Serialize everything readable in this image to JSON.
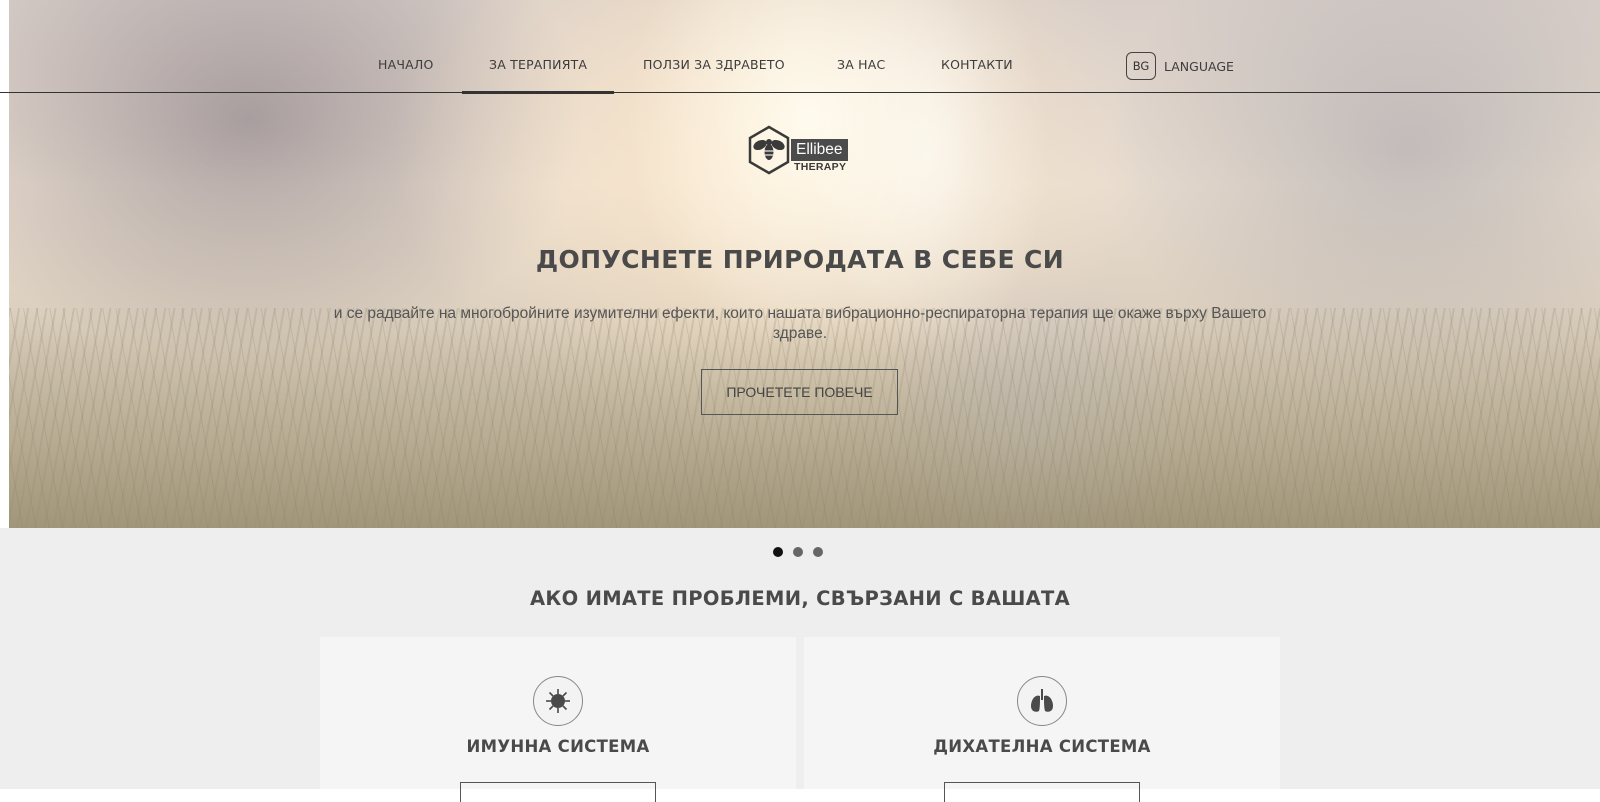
{
  "nav": {
    "items": [
      {
        "label": "НАЧАЛО"
      },
      {
        "label": "ЗА ТЕРАПИЯТА"
      },
      {
        "label": "ПОЛЗИ ЗА ЗДРАВЕТО"
      },
      {
        "label": "ЗА НАС"
      },
      {
        "label": "КОНТАКТИ"
      }
    ],
    "language": {
      "badge": "BG",
      "label": "LANGUAGE"
    }
  },
  "logo": {
    "name": "Ellibee",
    "sub": "THERAPY",
    "icon": "bee-hexagon-icon"
  },
  "hero": {
    "title": "ДОПУСНЕТЕ ПРИРОДАТА В СЕБЕ СИ",
    "text": "и се радвайте на многобройните изумителни ефекти, които нашата вибрационно-респираторна терапия ще окаже върху Вашето здраве.",
    "button": "ПРОЧЕТЕТЕ ПОВЕЧЕ"
  },
  "section": {
    "title": "АКО ИМАТЕ ПРОБЛЕМИ, СВЪРЗАНИ С ВАШАТА",
    "cards": [
      {
        "title": "ИМУННА СИСТЕМА",
        "icon": "virus-icon"
      },
      {
        "title": "ДИХАТЕЛНА СИСТЕМА",
        "icon": "lungs-icon"
      }
    ]
  },
  "colors": {
    "text": "#4a4a4a",
    "lower_bg": "#eeeeee",
    "card_bg": "#f5f5f5",
    "accent": "#333333"
  }
}
